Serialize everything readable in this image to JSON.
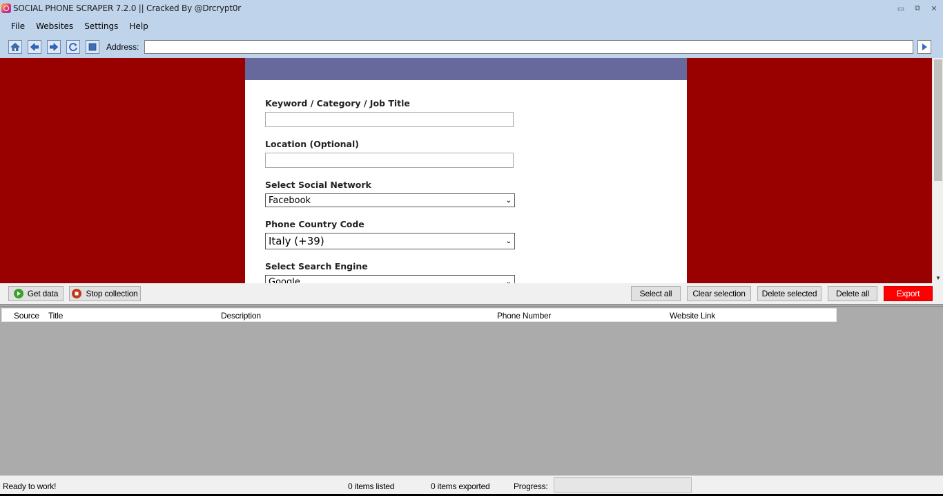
{
  "window": {
    "title": "SOCIAL PHONE SCRAPER 7.2.0 || Cracked By @Drcrypt0r",
    "icon": "instagram-icon"
  },
  "menu": [
    "File",
    "Websites",
    "Settings",
    "Help"
  ],
  "toolbar": {
    "buttons": [
      "home-icon",
      "back-arrow-icon",
      "forward-arrow-icon",
      "refresh-icon",
      "stop-icon"
    ],
    "address_label": "Address:",
    "address_value": ""
  },
  "form": {
    "keyword_label": "Keyword / Category / Job Title",
    "keyword_value": "",
    "location_label": "Location (Optional)",
    "location_value": "",
    "social_label": "Select Social Network",
    "social_value": "Facebook",
    "country_label": "Phone Country Code",
    "country_value": "Italy (+39)",
    "engine_label": "Select Search Engine",
    "engine_value": "Google"
  },
  "actions": {
    "get_data": "Get data",
    "stop_collection": "Stop collection",
    "select_all": "Select all",
    "clear_selection": "Clear selection",
    "delete_selected": "Delete selected",
    "delete_all": "Delete all",
    "export": "Export"
  },
  "columns": [
    "Source",
    "Title",
    "Description",
    "Phone Number",
    "Website Link"
  ],
  "status": {
    "message": "Ready to work!",
    "items_listed": "0 items listed",
    "items_exported": "0 items exported",
    "progress_label": "Progress:",
    "progress": 0
  },
  "colors": {
    "chrome": "#bfd3ea",
    "browser_bg": "#990000",
    "banner": "#67689c",
    "export": "#ff0000",
    "grid_bg": "#ababab"
  }
}
